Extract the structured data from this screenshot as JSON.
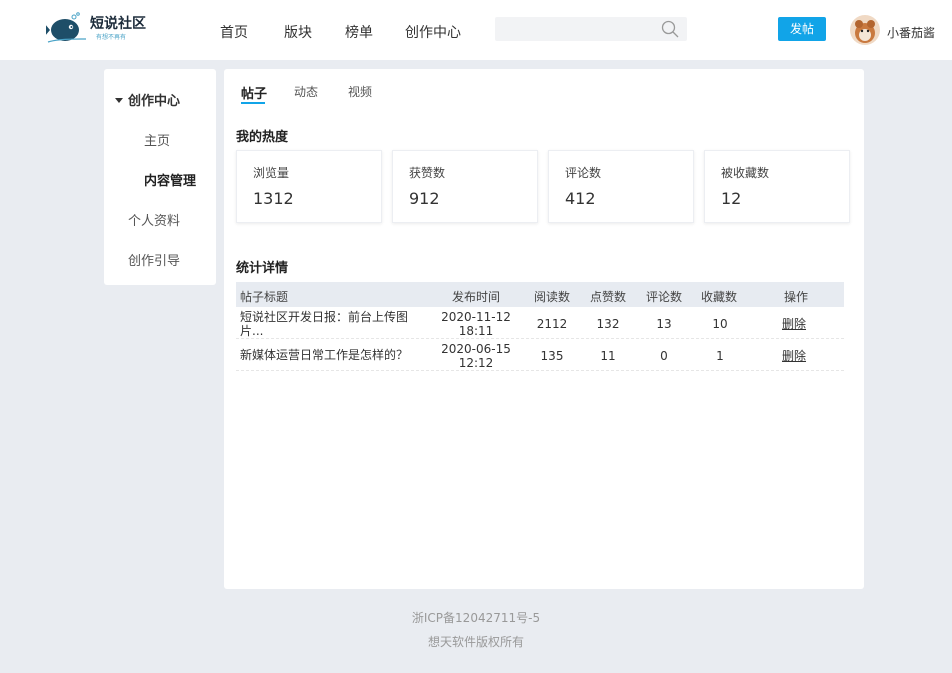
{
  "header": {
    "logo_text": "短说社区",
    "logo_slogan": "有想不再有",
    "nav": [
      "首页",
      "版块",
      "榜单",
      "创作中心"
    ],
    "search": {
      "value": "",
      "placeholder": ""
    },
    "post_button": "发帖",
    "username": "小番茄酱"
  },
  "sidebar": {
    "group_label": "创作中心",
    "sub_items": [
      "主页",
      "内容管理"
    ],
    "items": [
      "个人资料",
      "创作引导"
    ]
  },
  "main": {
    "tabs": [
      "帖子",
      "动态",
      "视频"
    ],
    "heat_title": "我的热度",
    "stats": [
      {
        "label": "浏览量",
        "value": "1312"
      },
      {
        "label": "获赞数",
        "value": "912"
      },
      {
        "label": "评论数",
        "value": "412"
      },
      {
        "label": "被收藏数",
        "value": "12"
      }
    ],
    "detail_title": "统计详情",
    "table": {
      "headers": [
        "帖子标题",
        "发布时间",
        "阅读数",
        "点赞数",
        "评论数",
        "收藏数",
        "操作"
      ],
      "rows": [
        {
          "title": "短说社区开发日报：前台上传图片...",
          "date": "2020-11-12",
          "time": "18:11",
          "reads": "2112",
          "likes": "132",
          "comments": "13",
          "favorites": "10",
          "action": "删除"
        },
        {
          "title": "新媒体运营日常工作是怎样的？",
          "date": "2020-06-15",
          "time": "12:12",
          "reads": "135",
          "likes": "11",
          "comments": "0",
          "favorites": "1",
          "action": "删除"
        }
      ]
    }
  },
  "footer": {
    "icp": "浙ICP备12042711号-5",
    "copyright": "想天软件版权所有"
  },
  "colors": {
    "accent": "#11a4e8",
    "page_bg": "#e9ecf1",
    "table_header_bg": "#e7ebf1"
  },
  "icons": [
    "logo-fish-icon",
    "search-icon",
    "caret-down-icon",
    "avatar-image"
  ]
}
